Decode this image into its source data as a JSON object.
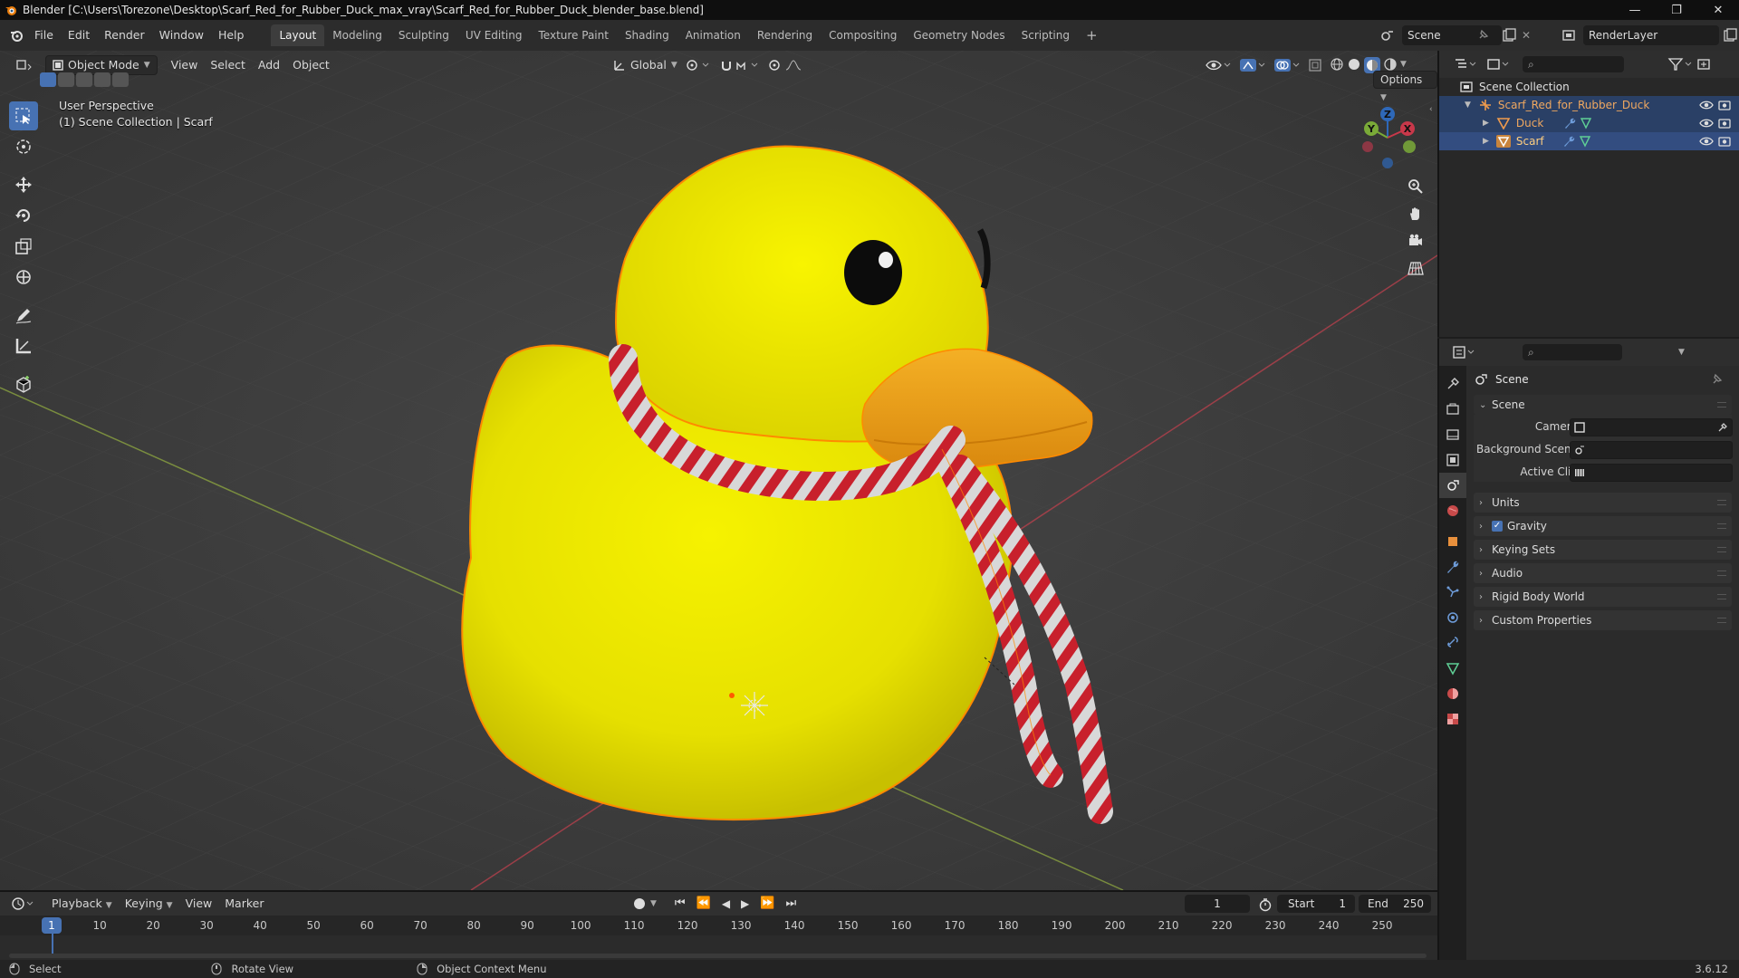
{
  "window": {
    "title": "Blender [C:\\Users\\Torezone\\Desktop\\Scarf_Red_for_Rubber_Duck_max_vray\\Scarf_Red_for_Rubber_Duck_blender_base.blend]",
    "minimize": "—",
    "maximize": "❐",
    "close": "✕"
  },
  "menubar": {
    "items": [
      "File",
      "Edit",
      "Render",
      "Window",
      "Help"
    ]
  },
  "workspaces": [
    "Layout",
    "Modeling",
    "Sculpting",
    "UV Editing",
    "Texture Paint",
    "Shading",
    "Animation",
    "Rendering",
    "Compositing",
    "Geometry Nodes",
    "Scripting"
  ],
  "workspace_add": "+",
  "scene_selector": {
    "value": "Scene"
  },
  "viewlayer_selector": {
    "value": "RenderLayer"
  },
  "viewport": {
    "mode": "Object Mode",
    "menus": [
      "View",
      "Select",
      "Add",
      "Object"
    ],
    "transform_orientation": "Global",
    "options_label": "Options",
    "perspective_label": "User Perspective",
    "collection_label": "(1) Scene Collection | Scarf",
    "gizmo": {
      "x": "X",
      "y": "Y",
      "z": "Z"
    }
  },
  "outliner": {
    "root": "Scene Collection",
    "items": [
      {
        "name": "Scarf_Red_for_Rubber_Duck",
        "level": 1
      },
      {
        "name": "Duck",
        "level": 2
      },
      {
        "name": "Scarf",
        "level": 2
      }
    ]
  },
  "properties": {
    "header": "Scene",
    "panel": "Scene",
    "fields": {
      "camera_label": "Camera",
      "background_scene_label": "Background Scene",
      "active_clip_label": "Active Clip"
    },
    "sections": [
      "Units",
      "Gravity",
      "Keying Sets",
      "Audio",
      "Rigid Body World",
      "Custom Properties"
    ]
  },
  "timeline": {
    "menus": [
      "Playback",
      "Keying",
      "View",
      "Marker"
    ],
    "current_frame": "1",
    "start_label": "Start",
    "start_value": "1",
    "end_label": "End",
    "end_value": "250",
    "ticks": [
      "1",
      "10",
      "20",
      "30",
      "40",
      "50",
      "60",
      "70",
      "80",
      "90",
      "100",
      "110",
      "120",
      "130",
      "140",
      "150",
      "160",
      "170",
      "180",
      "190",
      "200",
      "210",
      "220",
      "230",
      "240",
      "250"
    ]
  },
  "statusbar": {
    "select": "Select",
    "rotate": "Rotate View",
    "context": "Object Context Menu",
    "version": "3.6.12"
  },
  "colors": {
    "accent": "#4772b3",
    "selection": "#334d80",
    "duck_yellow": "#f0ec00",
    "beak_orange": "#f0a01c",
    "scarf_red": "#c8202c",
    "outline_orange": "#ff8a00"
  }
}
